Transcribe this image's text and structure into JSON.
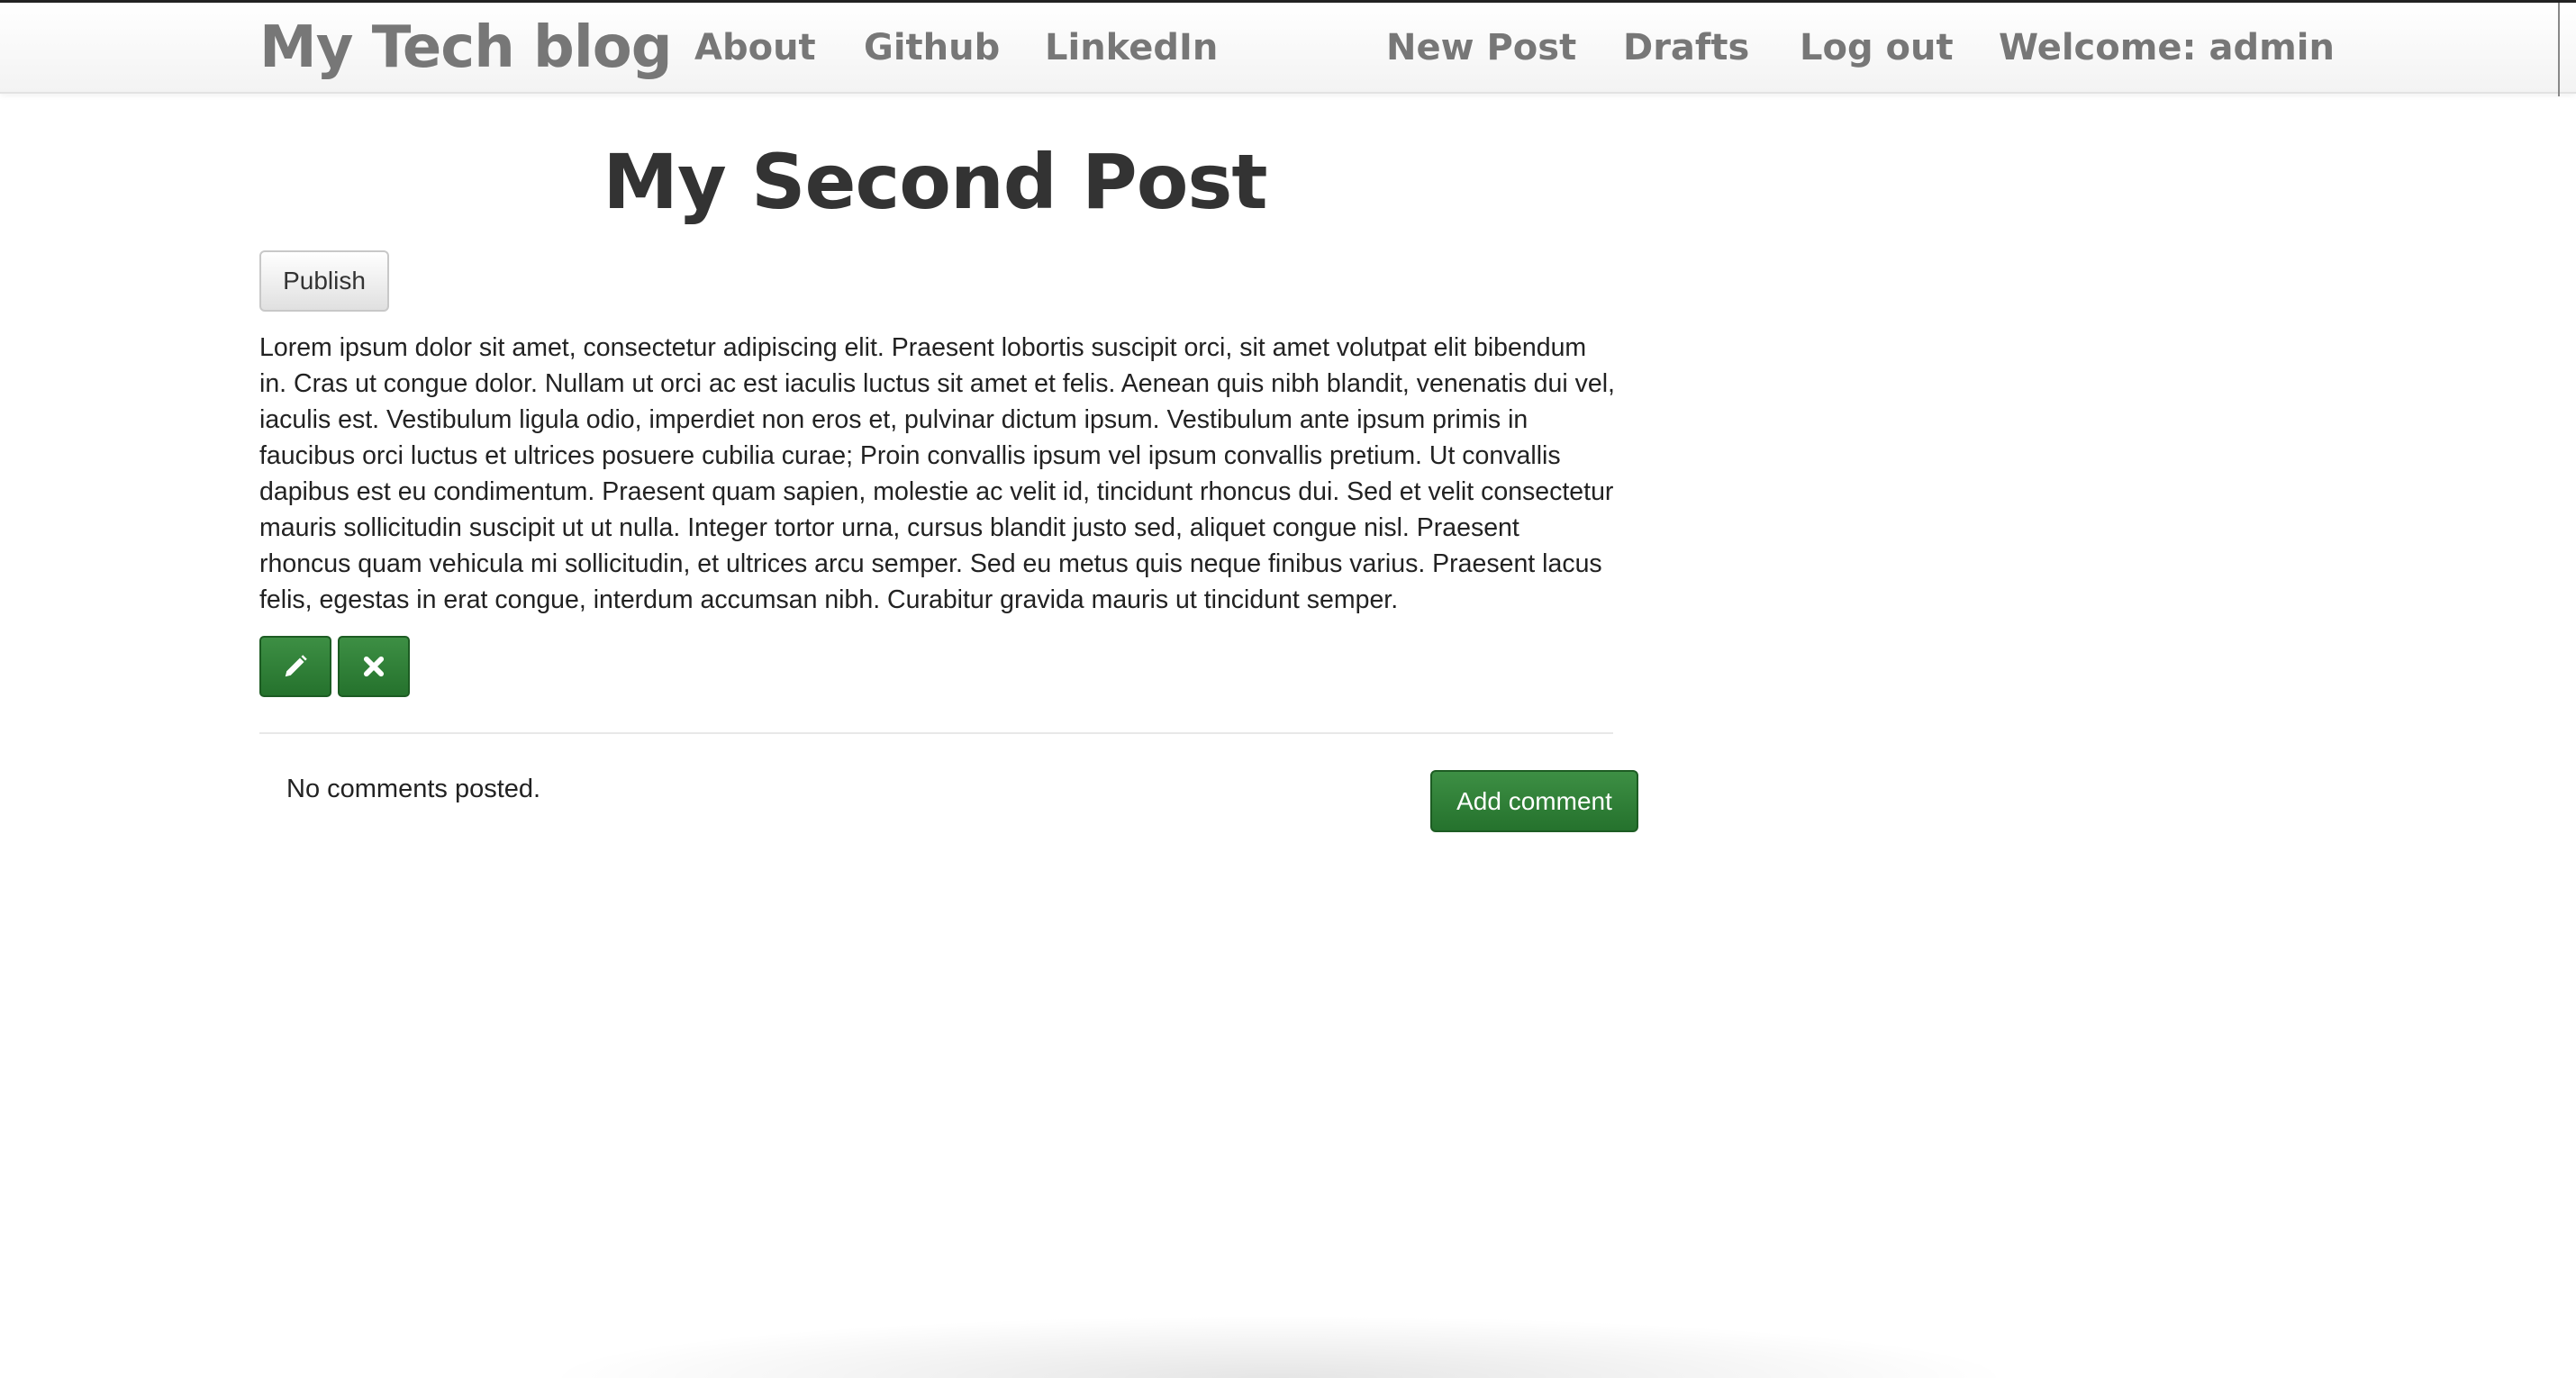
{
  "navbar": {
    "brand": "My Tech blog",
    "links": {
      "about": "About",
      "github": "Github",
      "linkedin": "LinkedIn"
    },
    "user_links": {
      "new_post": "New Post",
      "drafts": "Drafts",
      "log_out": "Log out",
      "welcome": "Welcome: admin"
    }
  },
  "post": {
    "title": "My Second Post",
    "publish_label": "Publish",
    "body": "Lorem ipsum dolor sit amet, consectetur adipiscing elit. Praesent lobortis suscipit orci, sit amet volutpat elit bibendum in. Cras ut congue dolor. Nullam ut orci ac est iaculis luctus sit amet et felis. Aenean quis nibh blandit, venenatis dui vel, iaculis est. Vestibulum ligula odio, imperdiet non eros et, pulvinar dictum ipsum. Vestibulum ante ipsum primis in faucibus orci luctus et ultrices posuere cubilia curae; Proin convallis ipsum vel ipsum convallis pretium. Ut convallis dapibus est eu condimentum. Praesent quam sapien, molestie ac velit id, tincidunt rhoncus dui. Sed et velit consectetur mauris sollicitudin suscipit ut ut nulla. Integer tortor urna, cursus blandit justo sed, aliquet congue nisl. Praesent rhoncus quam vehicula mi sollicitudin, et ultrices arcu semper. Sed eu metus quis neque finibus varius. Praesent lacus felis, egestas in erat congue, interdum accumsan nibh. Curabitur gravida mauris ut tincidunt semper.",
    "edit_icon": "pencil-icon",
    "delete_icon": "close-icon"
  },
  "comments": {
    "empty_text": "No comments posted.",
    "add_label": "Add comment"
  },
  "colors": {
    "accent_green": "#2e7d32",
    "nav_text": "#777777",
    "title_text": "#333333"
  }
}
